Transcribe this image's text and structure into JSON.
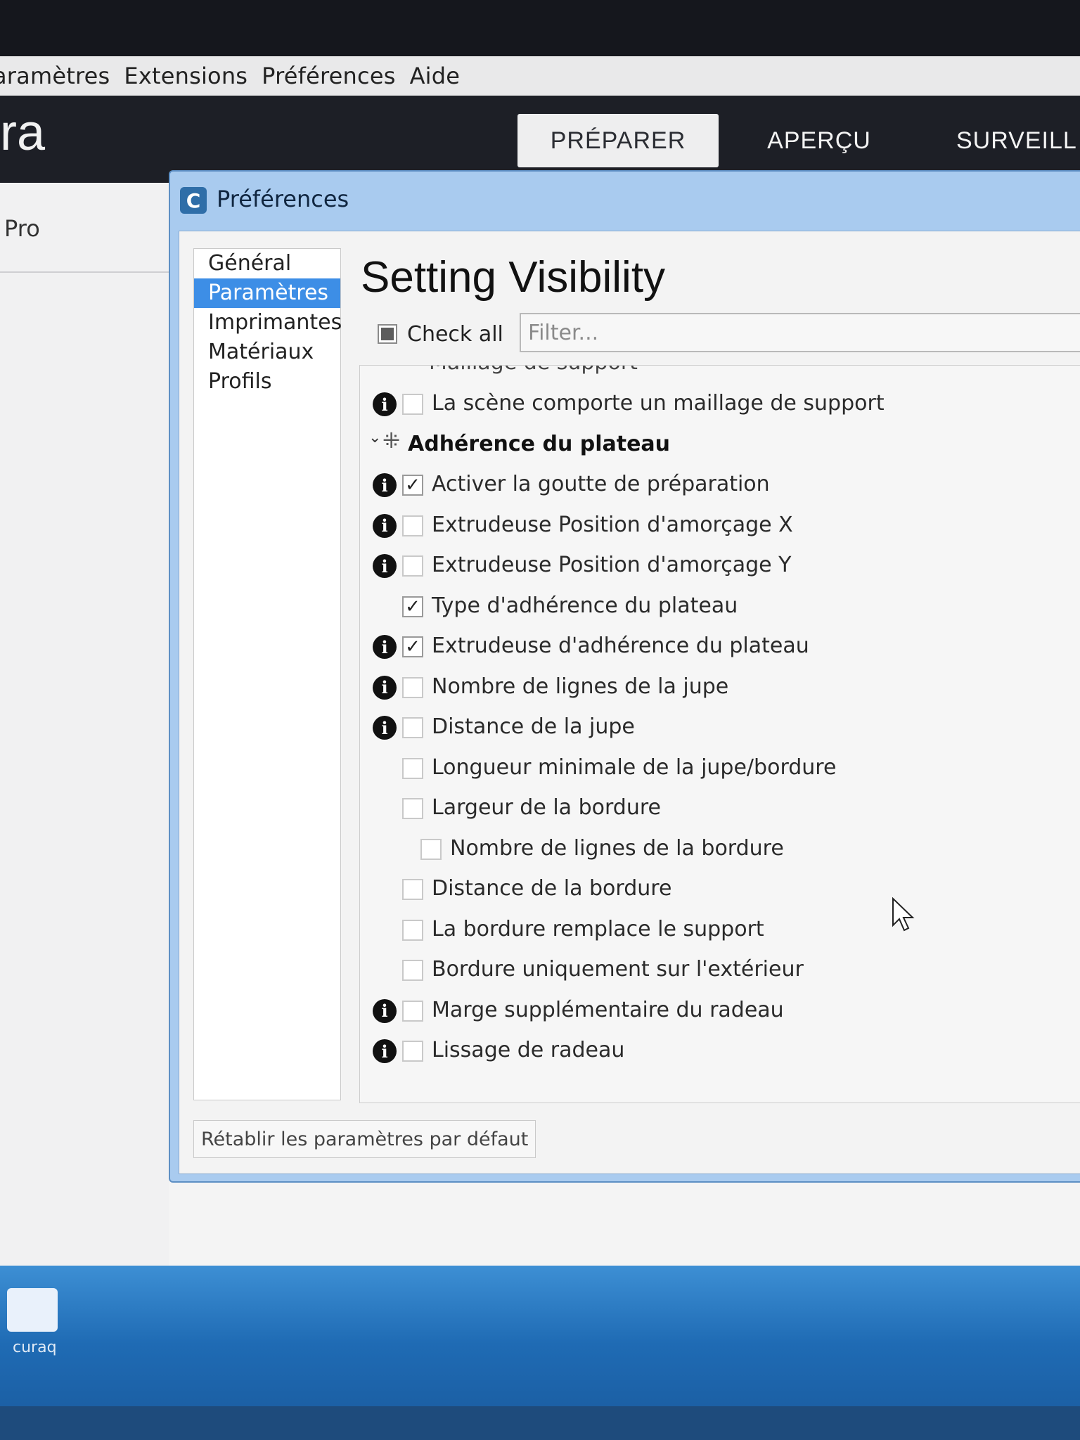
{
  "menubar": {
    "items": [
      "aramètres",
      "Extensions",
      "Préférences",
      "Aide"
    ]
  },
  "app": {
    "logo_fragment": "ra",
    "stages": [
      {
        "label": "PRÉPARER",
        "active": true
      },
      {
        "label": "APERÇU",
        "active": false
      },
      {
        "label": "SURVEILL",
        "active": false
      }
    ],
    "left_panel_text": "Pro"
  },
  "dialog": {
    "icon_letter": "C",
    "title": "Préférences",
    "nav": [
      {
        "label": "Général",
        "active": false
      },
      {
        "label": "Paramètres",
        "active": true
      },
      {
        "label": "Imprimantes",
        "active": false
      },
      {
        "label": "Matériaux",
        "active": false
      },
      {
        "label": "Profils",
        "active": false
      }
    ],
    "page_title": "Setting Visibility",
    "check_all_label": "Check all",
    "filter_placeholder": "Filter...",
    "reset_label": "Rétablir les paramètres par défaut",
    "settings": [
      {
        "label": "La scène comporte un maillage de support",
        "info": true,
        "checked": false
      },
      {
        "label": "Adhérence du plateau",
        "category": true
      },
      {
        "label": "Activer la goutte de préparation",
        "info": true,
        "checked": true
      },
      {
        "label": "Extrudeuse Position d'amorçage X",
        "info": true,
        "checked": false
      },
      {
        "label": "Extrudeuse Position d'amorçage Y",
        "info": true,
        "checked": false
      },
      {
        "label": "Type d'adhérence du plateau",
        "info": false,
        "checked": true
      },
      {
        "label": "Extrudeuse d'adhérence du plateau",
        "info": true,
        "checked": true
      },
      {
        "label": "Nombre de lignes de la jupe",
        "info": true,
        "checked": false
      },
      {
        "label": "Distance de la jupe",
        "info": true,
        "checked": false
      },
      {
        "label": "Longueur minimale de la jupe/bordure",
        "info": false,
        "checked": false
      },
      {
        "label": "Largeur de la bordure",
        "info": false,
        "checked": false
      },
      {
        "label": "Nombre de lignes de la bordure",
        "info": false,
        "checked": false,
        "indent": 1
      },
      {
        "label": "Distance de la bordure",
        "info": false,
        "checked": false
      },
      {
        "label": "La bordure remplace le support",
        "info": false,
        "checked": false
      },
      {
        "label": "Bordure uniquement sur l'extérieur",
        "info": false,
        "checked": false
      },
      {
        "label": "Marge supplémentaire du radeau",
        "info": true,
        "checked": false
      },
      {
        "label": "Lissage de radeau",
        "info": true,
        "checked": false
      }
    ]
  },
  "taskbar": {
    "icon_label": "curaq"
  },
  "colors": {
    "accent": "#3d8ee6",
    "dialog_frame": "#a9cbef",
    "app_header": "#1d1f26"
  }
}
